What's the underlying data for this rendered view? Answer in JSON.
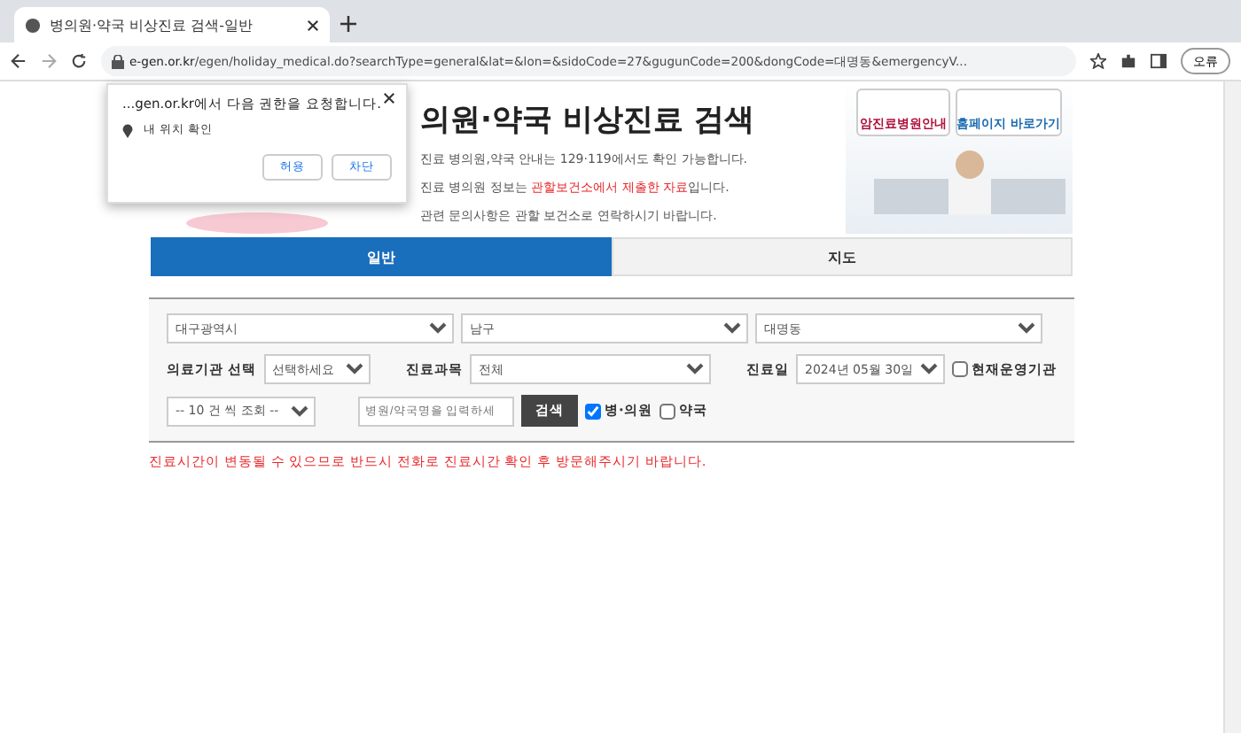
{
  "browser": {
    "tab_title": "병의원·약국 비상진료 검색-일반",
    "url_host": "e-gen.or.kr",
    "url_path": "/egen/holiday_medical.do?searchType=general&lat=&lon=&sidoCode=27&gugunCode=200&dongCode=대명동&emergencyV...",
    "profile_label": "오류"
  },
  "permission_popup": {
    "title": "...gen.or.kr에서 다음 권한을 요청합니다.",
    "permission": "내 위치 확인",
    "buttons": [
      "허용",
      "차단"
    ]
  },
  "header": {
    "title": "의원·약국 비상진료 검색",
    "lines": [
      {
        "segments": [
          {
            "text": "진료 병의원,약국 안내는 129·119에서도 확인 가능합니다.",
            "highlight": false
          }
        ]
      },
      {
        "segments": [
          {
            "text": "진료 병의원 정보는 ",
            "highlight": false
          },
          {
            "text": "관할보건소에서 제출한 자료",
            "highlight": true
          },
          {
            "text": "입니다.",
            "highlight": false
          }
        ]
      },
      {
        "segments": [
          {
            "text": "관련 문의사항은 관할 보건소로 연락하시기 바랍니다.",
            "highlight": false
          }
        ]
      }
    ],
    "banner_links": [
      "암진료병원안내",
      "홈페이지 바로가기"
    ]
  },
  "tabs": [
    {
      "label": "일반",
      "selected": true
    },
    {
      "label": "지도",
      "selected": false
    }
  ],
  "search": {
    "region_selects": [
      "대구광역시",
      "남구",
      "대명동"
    ],
    "institution_label": "의료기관 선택",
    "institution_value": "선택하세요",
    "department_label": "진료과목",
    "department_value": "전체",
    "date_label": "진료일",
    "date_value": "2024년 05월 30일",
    "open_now": {
      "label": "현재운영기관",
      "checked": false
    },
    "page_size": "-- 10 건 씩 조회 --",
    "name_placeholder": "병원/약국명을 입력하세",
    "search_button": "검색",
    "types": [
      {
        "label": "병·의원",
        "checked": true
      },
      {
        "label": "약국",
        "checked": false
      }
    ]
  },
  "notice": "진료시간이 변동될 수 있으므로 반드시 전화로 진료시간 확인 후 방문해주시기 바랍니다."
}
